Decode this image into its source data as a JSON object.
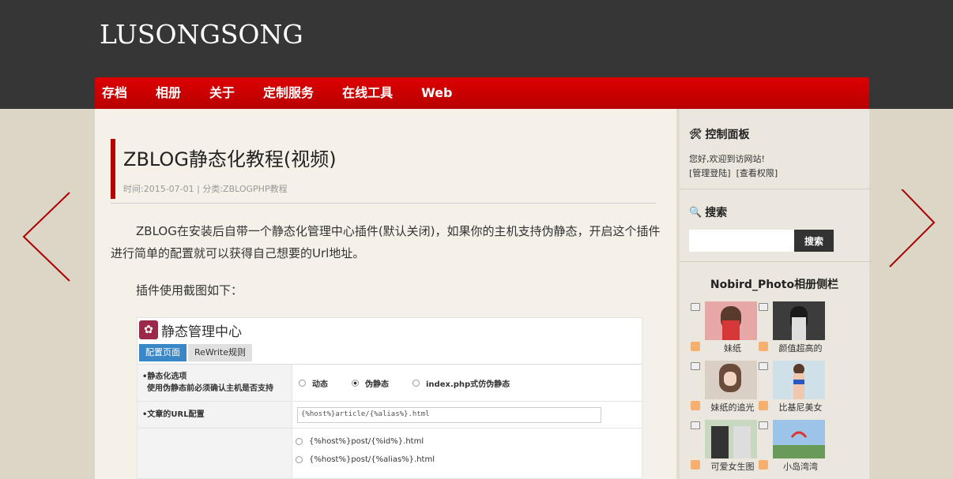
{
  "header": {
    "logo": "LUSONGSONG",
    "nav": [
      "存档",
      "相册",
      "关于",
      "定制服务",
      "在线工具",
      "Web"
    ]
  },
  "post": {
    "title": "ZBLOG静态化教程(视频)",
    "meta_time": "时间:2015-07-01",
    "meta_sep": " | ",
    "meta_category": "分类:ZBLOGPHP教程",
    "para1": "ZBLOG在安装后自带一个静态化管理中心插件(默认关闭)，如果你的主机支持伪静态，开启这个插件进行简单的配置就可以获得自己想要的Url地址。",
    "para2": "插件使用截图如下："
  },
  "screenshot": {
    "title": "静态管理中心",
    "tabs": [
      "配置页面",
      "ReWrite规则"
    ],
    "row1_label_1": "•静态化选项",
    "row1_label_2": "使用伪静态前必须确认主机是否支持",
    "row1_options": [
      "动态",
      "伪静态",
      "index.php式仿伪静态"
    ],
    "row2_label": "•文章的URL配置",
    "row2_value": "{%host%}article/{%alias%}.html",
    "row3_options": [
      "{%host%}post/{%id%}.html",
      "{%host%}post/{%alias%}.html"
    ]
  },
  "sidebar": {
    "control_title": "控制面板",
    "control_line1": "您好,欢迎到访网站!",
    "control_link1": "[管理登陆]",
    "control_link2": "[查看权限]",
    "search_title": "搜索",
    "search_button": "搜索",
    "photo_title": "Nobird_Photo相册侧栏",
    "photos": [
      "妹纸",
      "颜值超高的",
      "妹纸的追光",
      "比基尼美女",
      "可爱女生图",
      "小岛湾湾"
    ]
  },
  "colors": {
    "nav": "#c00000",
    "header": "#363636",
    "accent": "#b80000"
  }
}
